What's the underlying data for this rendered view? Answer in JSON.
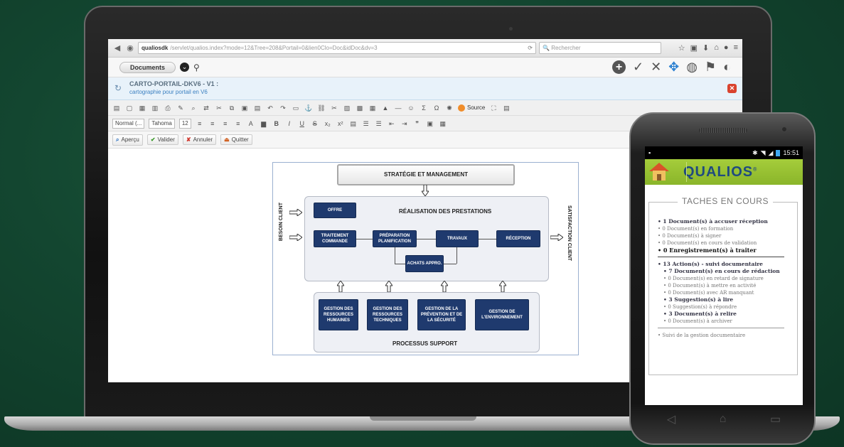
{
  "browser": {
    "url_host": "qualiosdk",
    "url_path": "/servlet/qualios.index?mode=12&Tree=208&Portail=0&lien0Clo=Doc&idDoc&dv=3",
    "search_placeholder": "Rechercher"
  },
  "app": {
    "documents_tab": "Documents"
  },
  "doc": {
    "title": "CARTO-PORTAIL-DKV6 - V1 :",
    "subtitle": "cartographie pour portail en V6"
  },
  "editor": {
    "source_label": "Source",
    "format_value": "Normal (...",
    "font_value": "Tahoma",
    "size_value": "12"
  },
  "actions": {
    "preview": "Aperçu",
    "validate": "Valider",
    "cancel": "Annuler",
    "quit": "Quitter"
  },
  "diagram": {
    "strategy": "STRATÉGIE ET MANAGEMENT",
    "realisation": "RÉALISATION DES PRESTATIONS",
    "besoin": "BESOIN CLIENT",
    "satisfaction": "SATISFACTION CLIENT",
    "offre": "OFFRE",
    "traitement": "TRAITEMENT COMMANDE",
    "preparation": "PRÉPARATION PLANIFICATION",
    "travaux": "TRAVAUX",
    "reception": "RÉCEPTION",
    "achats": "ACHATS APPRO.",
    "support_title": "PROCESSUS SUPPORT",
    "gestion_rh": "GESTION DES RESSOURCES HUMAINES",
    "gestion_rt": "GESTION DES RESSOURCES TECHNIQUES",
    "gestion_prev": "GESTION DE LA PRÉVENTION ET DE LA SÉCURITÉ",
    "gestion_env": "GESTION DE L'ENVIRONNEMENT"
  },
  "phone": {
    "time": "15:51",
    "brand": "QUALIOS",
    "tasks_title": "TACHES EN COURS",
    "tasks": [
      {
        "text": "• 1 Document(s) à accuser réception",
        "style": "bold"
      },
      {
        "text": "• 0 Document(s) en formation",
        "style": ""
      },
      {
        "text": "• 0 Document(s) à signer",
        "style": ""
      },
      {
        "text": "• 0 Document(s) en cours de validation",
        "style": ""
      },
      {
        "text": "• 0 Enregistrement(s) à traiter",
        "style": "black"
      }
    ],
    "actions_block": [
      {
        "text": "• 13 Action(s) - suivi documentaire",
        "style": "bold"
      },
      {
        "text": "• 7 Document(s) en cours de rédaction",
        "style": "bold sub"
      },
      {
        "text": "• 0 Document(s) en retard de signature",
        "style": "sub"
      },
      {
        "text": "• 0 Document(s) à mettre en activité",
        "style": "sub"
      },
      {
        "text": "• 0 Document(s) avec AR manquant",
        "style": "sub"
      },
      {
        "text": "• 3 Suggestion(s) à lire",
        "style": "bold sub"
      },
      {
        "text": "• 0 Suggestion(s) à répondre",
        "style": "sub"
      },
      {
        "text": "• 3 Document(s) à relire",
        "style": "bold sub"
      },
      {
        "text": "• 0 Document(s) à archiver",
        "style": "sub"
      }
    ],
    "footer_link": "• Suivi de la gestion documentaire"
  }
}
